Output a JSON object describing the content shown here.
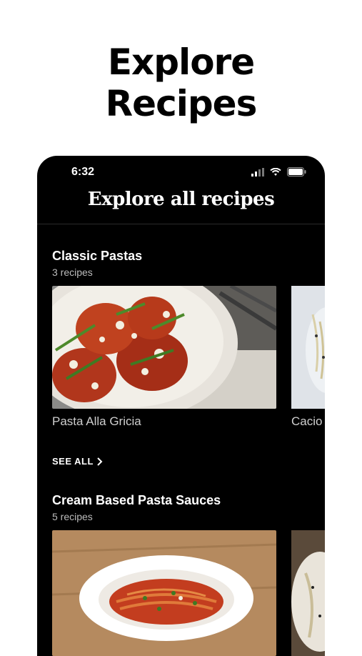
{
  "headline": {
    "line1": "Explore",
    "line2": "Recipes"
  },
  "status_bar": {
    "time": "6:32"
  },
  "screen": {
    "title": "Explore all recipes"
  },
  "sections": [
    {
      "title": "Classic Pastas",
      "count": "3 recipes",
      "cards": [
        {
          "label": "Pasta Alla Gricia",
          "image": "meatballs-in-bowl"
        },
        {
          "label": "Cacio",
          "image": "cacio-pasta"
        }
      ],
      "see_all": "SEE ALL"
    },
    {
      "title": "Cream Based Pasta Sauces",
      "count": "5 recipes",
      "cards": [
        {
          "label": "",
          "image": "spaghetti-bolognese"
        },
        {
          "label": "",
          "image": "cheese-pasta"
        }
      ]
    }
  ],
  "colors": {
    "background": "#ffffff",
    "phone": "#000000",
    "text": "#ffffff",
    "muted": "#bbbbbb"
  }
}
